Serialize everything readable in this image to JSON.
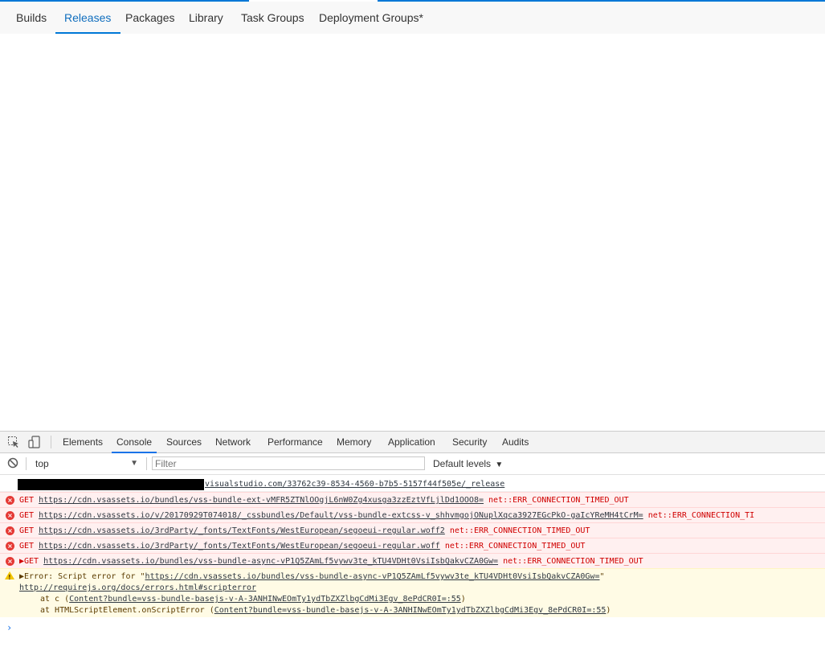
{
  "colors": {
    "accent": "#0078d7",
    "error": "#d00000",
    "warning": "#f2c500",
    "devtools_accent": "#1a73e8"
  },
  "nav": {
    "tabs": [
      {
        "label": "Builds"
      },
      {
        "label": "Releases",
        "active": true
      },
      {
        "label": "Packages"
      },
      {
        "label": "Library"
      },
      {
        "label": "Task Groups"
      },
      {
        "label": "Deployment Groups*"
      }
    ]
  },
  "devtools": {
    "icons": [
      "inspect-element-icon",
      "device-toolbar-icon",
      "clear-console-icon"
    ],
    "tabs": [
      {
        "label": "Elements"
      },
      {
        "label": "Console",
        "active": true
      },
      {
        "label": "Sources"
      },
      {
        "label": "Network"
      },
      {
        "label": "Performance"
      },
      {
        "label": "Memory"
      },
      {
        "label": "Application"
      },
      {
        "label": "Security"
      },
      {
        "label": "Audits"
      }
    ],
    "context": "top",
    "filter_placeholder": "Filter",
    "levels": "Default levels"
  },
  "console": {
    "messages": [
      {
        "type": "log",
        "text": "visualstudio.com/33762c39-8534-4560-b7b5-5157f44f505e/_release"
      },
      {
        "type": "error",
        "method": "GET",
        "url": "https://cdn.vsassets.io/bundles/vss-bundle-ext-vMFR5ZTNlOOgjL6nW0Zg4xusga3zzEztVfLjlDd1OOO8=",
        "status": "net::ERR_CONNECTION_TIMED_OUT"
      },
      {
        "type": "error",
        "method": "GET",
        "url": "https://cdn.vsassets.io/v/20170929T074018/_cssbundles/Default/vss-bundle-extcss-v_shhvmgojONuplXqca3927EGcPkO-gaIcYReMH4tCrM=",
        "status": "net::ERR_CONNECTION_TI"
      },
      {
        "type": "error",
        "method": "GET",
        "url": "https://cdn.vsassets.io/3rdParty/_fonts/TextFonts/WestEuropean/segoeui-regular.woff2",
        "status": "net::ERR_CONNECTION_TIMED_OUT"
      },
      {
        "type": "error",
        "method": "GET",
        "url": "https://cdn.vsassets.io/3rdParty/_fonts/TextFonts/WestEuropean/segoeui-regular.woff",
        "status": "net::ERR_CONNECTION_TIMED_OUT"
      },
      {
        "type": "error",
        "method": "▶GET",
        "url": "https://cdn.vsassets.io/bundles/vss-bundle-async-vP1Q5ZAmLf5vywv3te_kTU4VDHt0VsiIsbQakvCZA0Gw=",
        "status": "net::ERR_CONNECTION_TIMED_OUT"
      }
    ],
    "warning": {
      "prefix": "▶Error: Script error for \"",
      "url": "https://cdn.vsassets.io/bundles/vss-bundle-async-vP1Q5ZAmLf5vywv3te_kTU4VDHt0VsiIsbQakvCZA0Gw=",
      "suffix": "\"",
      "doc_link": "http://requirejs.org/docs/errors.html#scripterror",
      "stack1_prefix": "at c (",
      "stack1_link": "Content?bundle=vss-bundle-basejs-v-A-3ANHINwEOmTy1ydTbZXZlbgCdMi3Egv_8ePdCR0I=:55",
      "stack1_suffix": ")",
      "stack2_prefix": "at HTMLScriptElement.onScriptError (",
      "stack2_link": "Content?bundle=vss-bundle-basejs-v-A-3ANHINwEOmTy1ydTbZXZlbgCdMi3Egv_8ePdCR0I=:55",
      "stack2_suffix": ")"
    },
    "prompt": "›"
  }
}
